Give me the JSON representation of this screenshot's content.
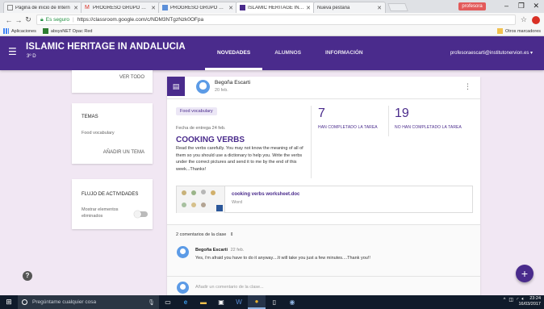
{
  "browser": {
    "tabs": [
      {
        "title": "Página de inicio de Intern",
        "active": false
      },
      {
        "title": "PROGRESO GRUPO DE T",
        "active": false
      },
      {
        "title": "PROGRESO GRUPO DE T",
        "active": false
      },
      {
        "title": "ISLAMIC HERITAGE IN AN",
        "active": true
      },
      {
        "title": "Nueva pestaña",
        "active": false
      }
    ],
    "user_label": "profesora",
    "minimize": "–",
    "maximize": "❐",
    "close": "✕",
    "secure_label": "Es seguro",
    "url": "https://classroom.google.com/c/NDM3NTgzNzk0OFpa",
    "bookmarks": [
      "Aplicaciones",
      "absysNET Opac Red"
    ],
    "other_bookmarks": "Otros marcadores"
  },
  "header": {
    "class_title": "ISLAMIC HERITAGE IN ANDALUCIA",
    "class_subtitle": "3º D",
    "tabs": [
      {
        "label": "NOVEDADES",
        "active": true
      },
      {
        "label": "ALUMNOS",
        "active": false
      },
      {
        "label": "INFORMACIÓN",
        "active": false
      }
    ],
    "user_email": "profesoraescarti@institutonervion.es ▾"
  },
  "sidebar": {
    "ver_todo": "VER TODO",
    "temas": {
      "title": "TEMAS",
      "item": "Food vocabulary",
      "add_button": "AÑADIR UN TEMA"
    },
    "flujo": {
      "title": "FLUJO DE ACTIVIDADES",
      "option": "Mostrar elementos eliminados"
    }
  },
  "post": {
    "author": "Begoña Escarti",
    "date": "20 feb.",
    "topic_chip": "Food vocabulary",
    "due": "Fecha de entrega 24 feb.",
    "title": "COOKING VERBS",
    "description": "Read the verbs carefully. You may not know the meaning of all of them so you should use a dictionary to help you. Write the verbs under the correct pictures and send it to me by the end of this week...Thanks!",
    "stats": [
      {
        "value": "7",
        "label": "HAN COMPLETADO LA TAREA"
      },
      {
        "value": "19",
        "label": "NO HAN COMPLETADO LA TAREA"
      }
    ],
    "attachment": {
      "name": "cooking verbs worksheet.doc",
      "type": "Word"
    },
    "comments_count": "2 comentarios de la clase",
    "comment": {
      "author": "Begoña Escarti",
      "date": "22 feb.",
      "text": "Yes, i'm afraid you have to do it anyway....It will take you just a few minutes....Thank you!!"
    },
    "add_comment_placeholder": "Añadir un comentario de la clase..."
  },
  "taskbar": {
    "search_placeholder": "Pregúntame cualquier cosa",
    "time": "23:24",
    "date": "16/03/2017"
  },
  "colors": {
    "brand": "#4a2b8c",
    "background": "#f1e7f3",
    "taskbar": "#101b2b"
  }
}
